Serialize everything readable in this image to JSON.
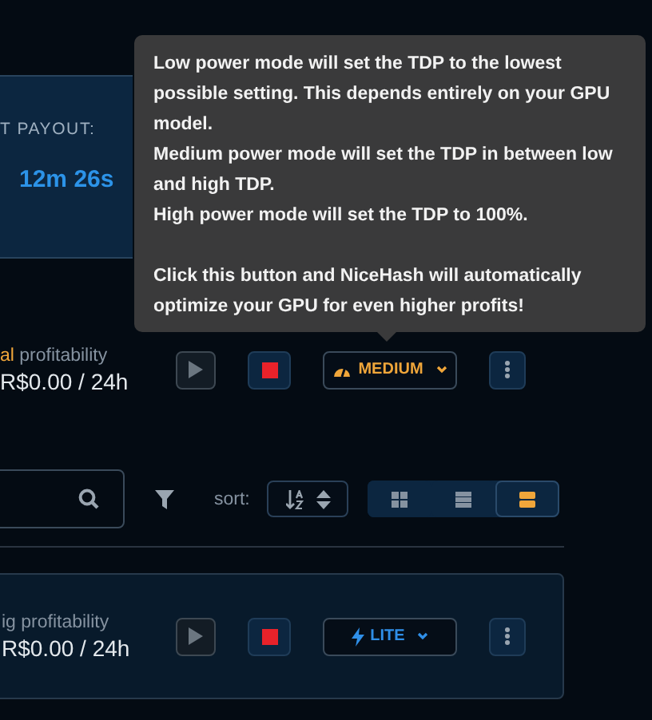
{
  "payout": {
    "label": "T PAYOUT:",
    "time": "12m 26s"
  },
  "tooltip": {
    "lines": [
      "Low power mode will set the TDP to the lowest possible setting. This depends entirely on your GPU model.",
      "Medium power mode will set the TDP in between low and high TDP.",
      "High power mode will set the TDP to 100%.",
      "Click this button and NiceHash will automatically optimize your GPU for even higher profits!"
    ]
  },
  "rigs": [
    {
      "kind": "plain",
      "label_highlight": "al",
      "label": " profitability",
      "profit": "R$0.00 / 24h",
      "mode": {
        "kind": "medium",
        "label": "MEDIUM"
      }
    },
    {
      "kind": "card",
      "label": "ig profitability",
      "profit": "R$0.00 / 24h",
      "mode": {
        "kind": "lite",
        "label": "LITE"
      }
    }
  ],
  "toolbar": {
    "sort_label": "sort:",
    "views": [
      {
        "kind": "grid",
        "selected": false
      },
      {
        "kind": "list",
        "selected": false
      },
      {
        "kind": "rows",
        "selected": true
      }
    ]
  }
}
